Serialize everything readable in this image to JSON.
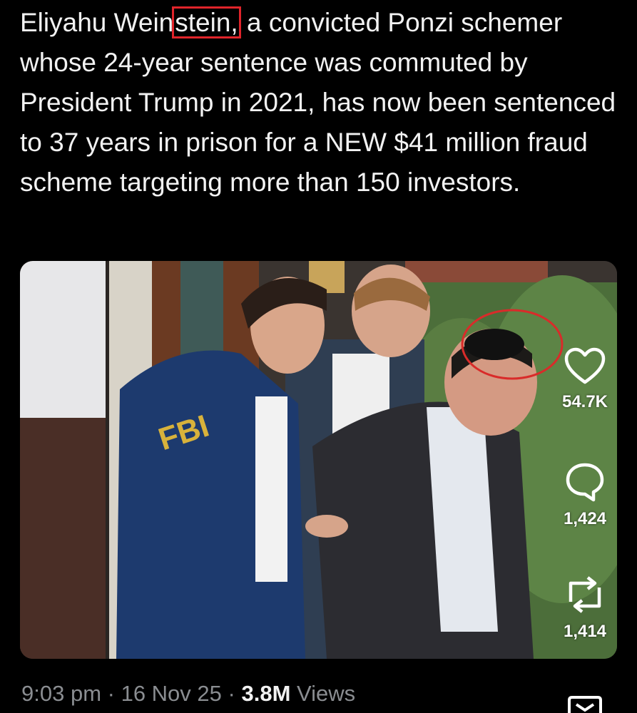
{
  "tweet": {
    "text_before": "Eliyahu Wein",
    "text_highlight": "stein,",
    "text_after": " a convicted Ponzi schemer whose 24-year sentence was commuted by President Trump in 2021, has now been sentenced to 37 years in prison for a NEW $41 million fraud scheme targeting more than 150 investors."
  },
  "photo": {
    "jacket_lettering": "FBI"
  },
  "actions": {
    "like_count": "54.7K",
    "reply_count": "1,424",
    "repost_count": "1,414"
  },
  "meta": {
    "time": "9:03 pm",
    "sep1": " · ",
    "date": "16 Nov 25",
    "sep2": " · ",
    "views_count": "3.8M",
    "views_label": " Views"
  },
  "colors": {
    "highlight": "#e0242a",
    "background": "#000000",
    "secondary_text": "#8a8d91"
  },
  "icons": [
    "heart-icon",
    "reply-icon",
    "repost-icon",
    "bookmark-icon"
  ]
}
